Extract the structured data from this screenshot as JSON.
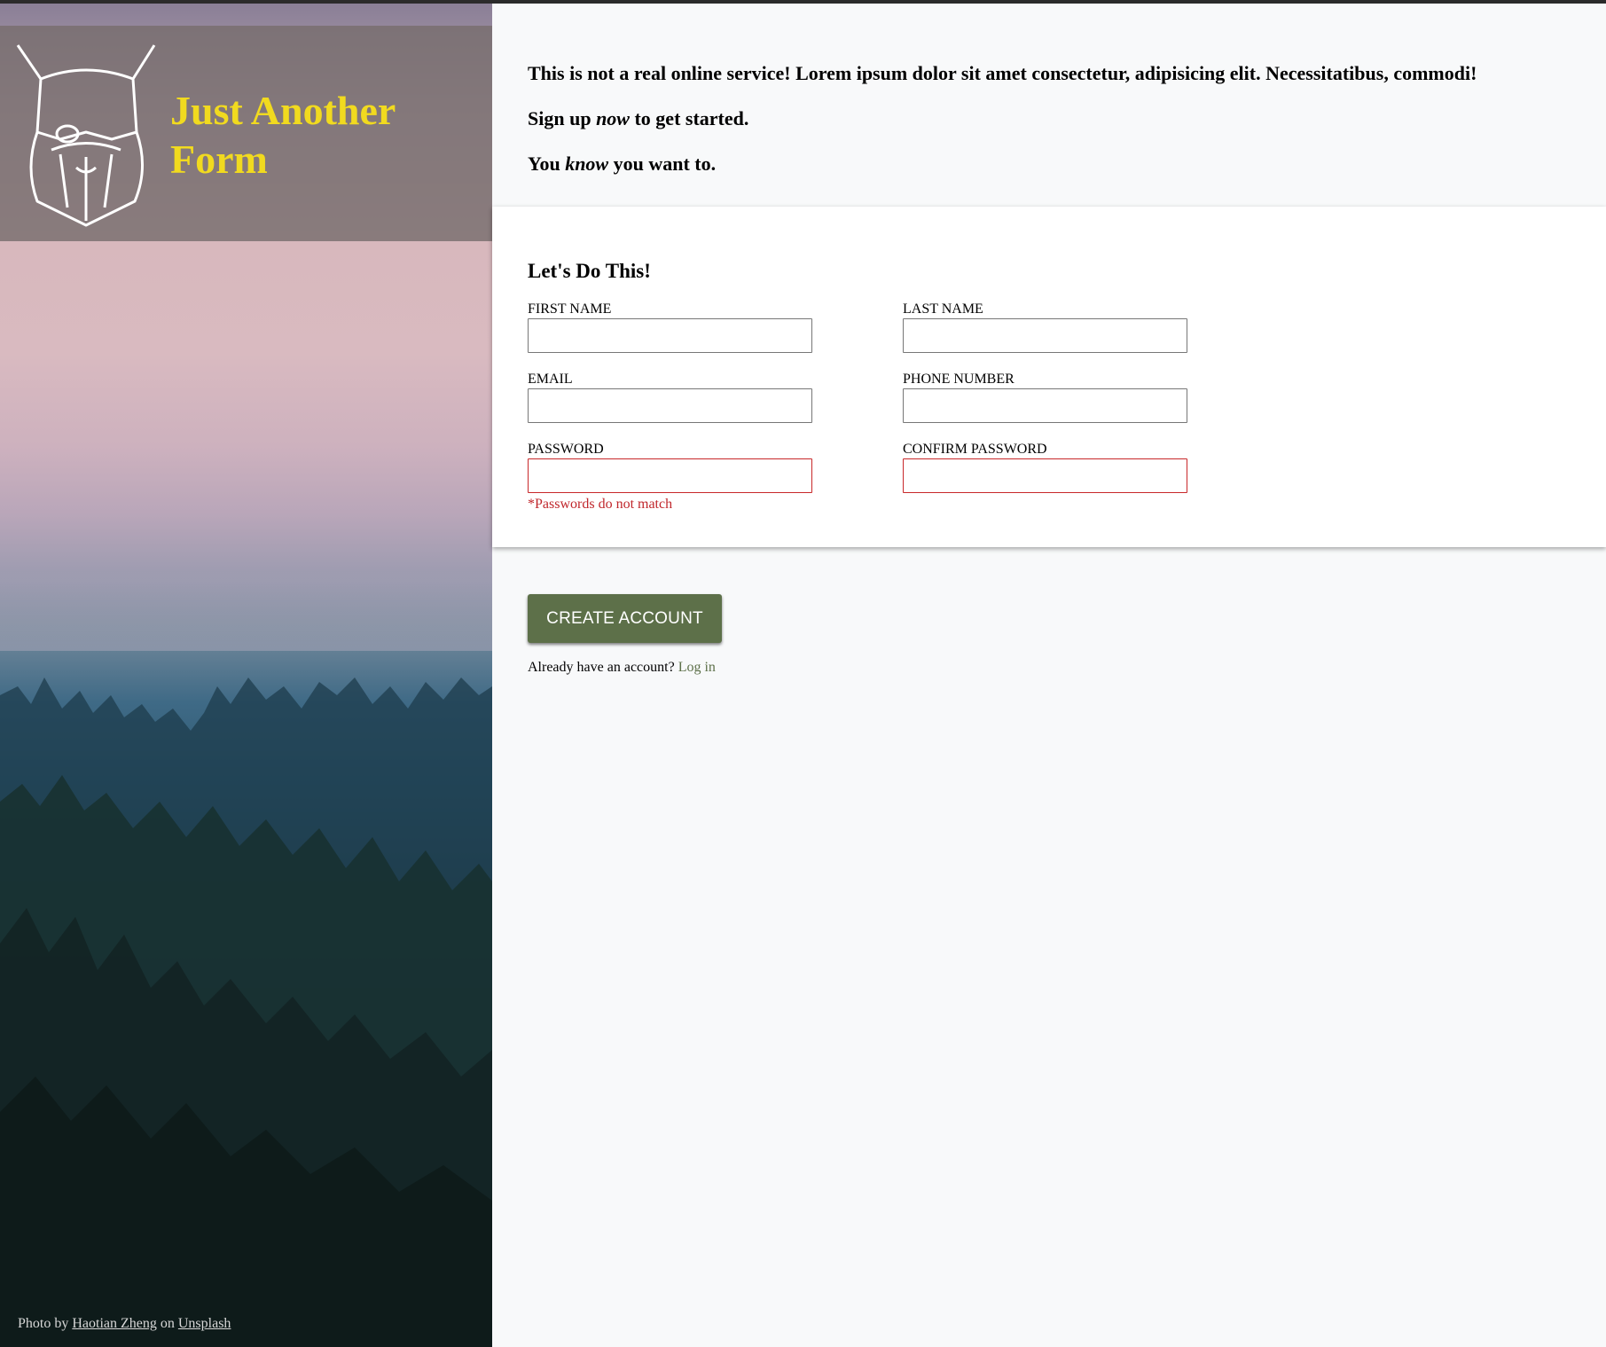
{
  "brand": {
    "title": "Just Another Form",
    "logo_icon": "viking-beard-icon",
    "title_color": "#f1da1f"
  },
  "photo_credit": {
    "prefix": "Photo by",
    "author": "Haotian Zheng",
    "middle": "on",
    "source": "Unsplash"
  },
  "intro": {
    "line1": "This is not a real online service! Lorem ipsum dolor sit amet consectetur, adipisicing elit. Necessitatibus, commodi!",
    "line2_a": "Sign up",
    "line2_em": "now",
    "line2_b": "to get started.",
    "line3_a": "You",
    "line3_em": "know",
    "line3_b": "you want to."
  },
  "form": {
    "title": "Let's Do This!",
    "fields": {
      "first_name": {
        "label": "FIRST NAME",
        "value": ""
      },
      "last_name": {
        "label": "LAST NAME",
        "value": ""
      },
      "email": {
        "label": "EMAIL",
        "value": ""
      },
      "phone": {
        "label": "PHONE NUMBER",
        "value": ""
      },
      "password": {
        "label": "PASSWORD",
        "value": ""
      },
      "confirm_password": {
        "label": "CONFIRM PASSWORD",
        "value": ""
      }
    },
    "error": "*Passwords do not match",
    "error_color": "#c0262b"
  },
  "actions": {
    "create_label": "CREATE ACCOUNT",
    "button_color": "#5d7049",
    "login_prompt": "Already have an account?",
    "login_link": "Log in"
  }
}
